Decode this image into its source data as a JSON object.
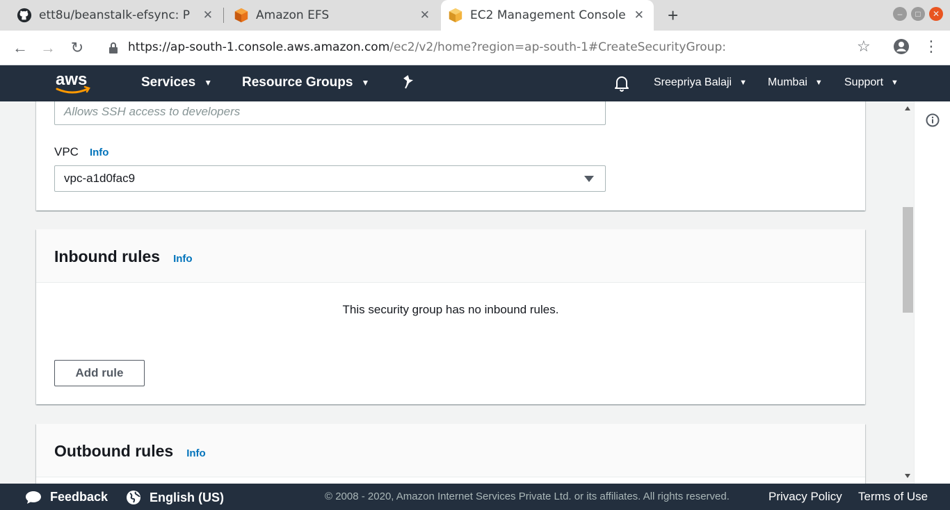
{
  "browser": {
    "tabs": [
      {
        "title": "ett8u/beanstalk-efsync: P",
        "favicon": "github-icon"
      },
      {
        "title": "Amazon EFS",
        "favicon": "aws-box-icon"
      },
      {
        "title": "EC2 Management Console",
        "favicon": "aws-box-icon",
        "active": true
      }
    ],
    "close_glyph": "✕",
    "newtab_glyph": "+",
    "url_host": "https://ap-south-1.console.aws.amazon.com",
    "url_path": "/ec2/v2/home?region=ap-south-1#CreateSecurityGroup:"
  },
  "aws_nav": {
    "services": "Services",
    "resource_groups": "Resource Groups",
    "user": "Sreepriya Balaji",
    "region": "Mumbai",
    "support": "Support",
    "chevron": "▼"
  },
  "form": {
    "description_placeholder": "Allows SSH access to developers",
    "vpc_label": "VPC",
    "info": "Info",
    "vpc_value": "vpc-a1d0fac9"
  },
  "inbound": {
    "title": "Inbound rules",
    "info": "Info",
    "empty_message": "This security group has no inbound rules.",
    "add_rule": "Add rule"
  },
  "outbound": {
    "title": "Outbound rules",
    "info": "Info"
  },
  "footer": {
    "feedback": "Feedback",
    "language": "English (US)",
    "copyright": "© 2008 - 2020, Amazon Internet Services Private Ltd. or its affiliates. All rights reserved.",
    "privacy": "Privacy Policy",
    "terms": "Terms of Use"
  },
  "colors": {
    "aws_navy": "#232f3e",
    "aws_orange": "#ff9900",
    "link_blue": "#0073bb"
  }
}
